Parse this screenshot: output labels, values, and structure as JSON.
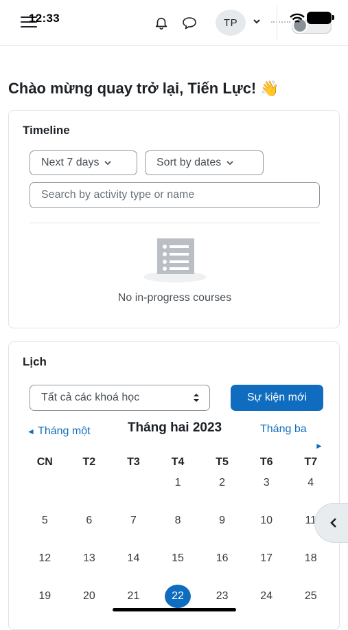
{
  "status_bar": {
    "time": "12:33"
  },
  "header": {
    "avatar_initials": "TP"
  },
  "welcome": "Chào mừng quay trở lại, Tiến Lực! 👋",
  "timeline": {
    "title": "Timeline",
    "filter_label": "Next 7 days",
    "sort_label": "Sort by dates",
    "search_placeholder": "Search by activity type or name",
    "empty_text": "No in-progress courses"
  },
  "calendar": {
    "title": "Lịch",
    "course_select": "Tất cả các khoá học",
    "new_event_label": "Sự kiện mới",
    "prev_month_arrow": "◄",
    "prev_month": "Tháng một",
    "current_month": "Tháng hai 2023",
    "next_month": "Tháng ba",
    "next_month_arrow": "►",
    "weekdays": [
      "CN",
      "T2",
      "T3",
      "T4",
      "T5",
      "T6",
      "T7"
    ],
    "weeks": [
      [
        "",
        "",
        "",
        "1",
        "2",
        "3",
        "4"
      ],
      [
        "5",
        "6",
        "7",
        "8",
        "9",
        "10",
        "11"
      ],
      [
        "12",
        "13",
        "14",
        "15",
        "16",
        "17",
        "18"
      ],
      [
        "19",
        "20",
        "21",
        "22",
        "23",
        "24",
        "25"
      ]
    ],
    "today": "22"
  },
  "colors": {
    "accent": "#0f6cbf",
    "text": "#1d2125",
    "border": "#dee2e6"
  }
}
